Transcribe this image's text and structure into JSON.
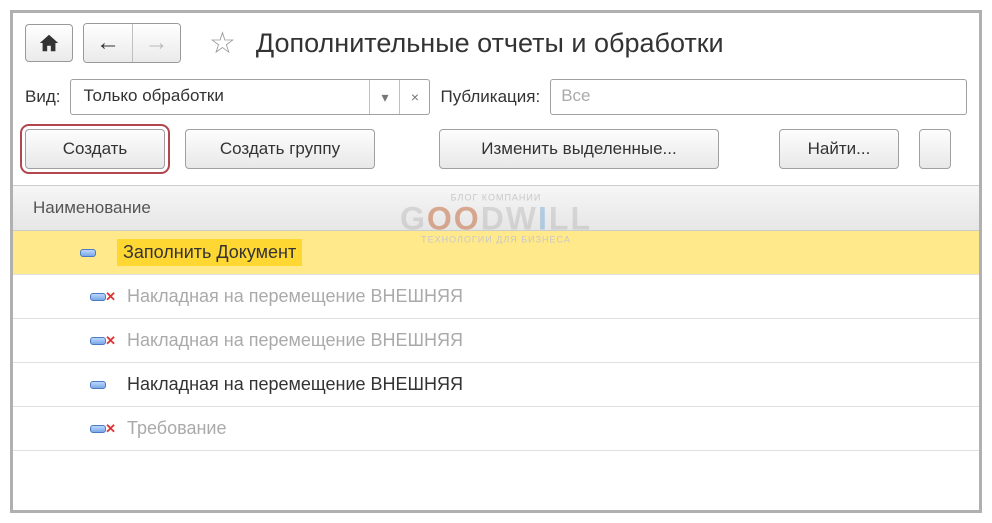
{
  "header": {
    "title": "Дополнительные отчеты и обработки"
  },
  "filter": {
    "type_label": "Вид:",
    "type_value": "Только обработки",
    "publication_label": "Публикация:",
    "publication_placeholder": "Все"
  },
  "toolbar": {
    "create": "Создать",
    "create_group": "Создать группу",
    "change_selected": "Изменить выделенные...",
    "find": "Найти..."
  },
  "table": {
    "header": "Наименование",
    "rows": [
      {
        "label": "Заполнить Документ",
        "selected": true,
        "disabled": false,
        "deleted": false
      },
      {
        "label": "Накладная на перемещение ВНЕШНЯЯ",
        "selected": false,
        "disabled": true,
        "deleted": true
      },
      {
        "label": "Накладная на перемещение ВНЕШНЯЯ",
        "selected": false,
        "disabled": true,
        "deleted": true
      },
      {
        "label": "Накладная на перемещение ВНЕШНЯЯ",
        "selected": false,
        "disabled": false,
        "deleted": false
      },
      {
        "label": "Требование",
        "selected": false,
        "disabled": true,
        "deleted": true
      }
    ]
  },
  "watermark": {
    "top": "БЛОГ КОМПАНИИ",
    "main": "GOODWILL",
    "sub": "ТЕХНОЛОГИИ ДЛЯ БИЗНЕСА"
  }
}
